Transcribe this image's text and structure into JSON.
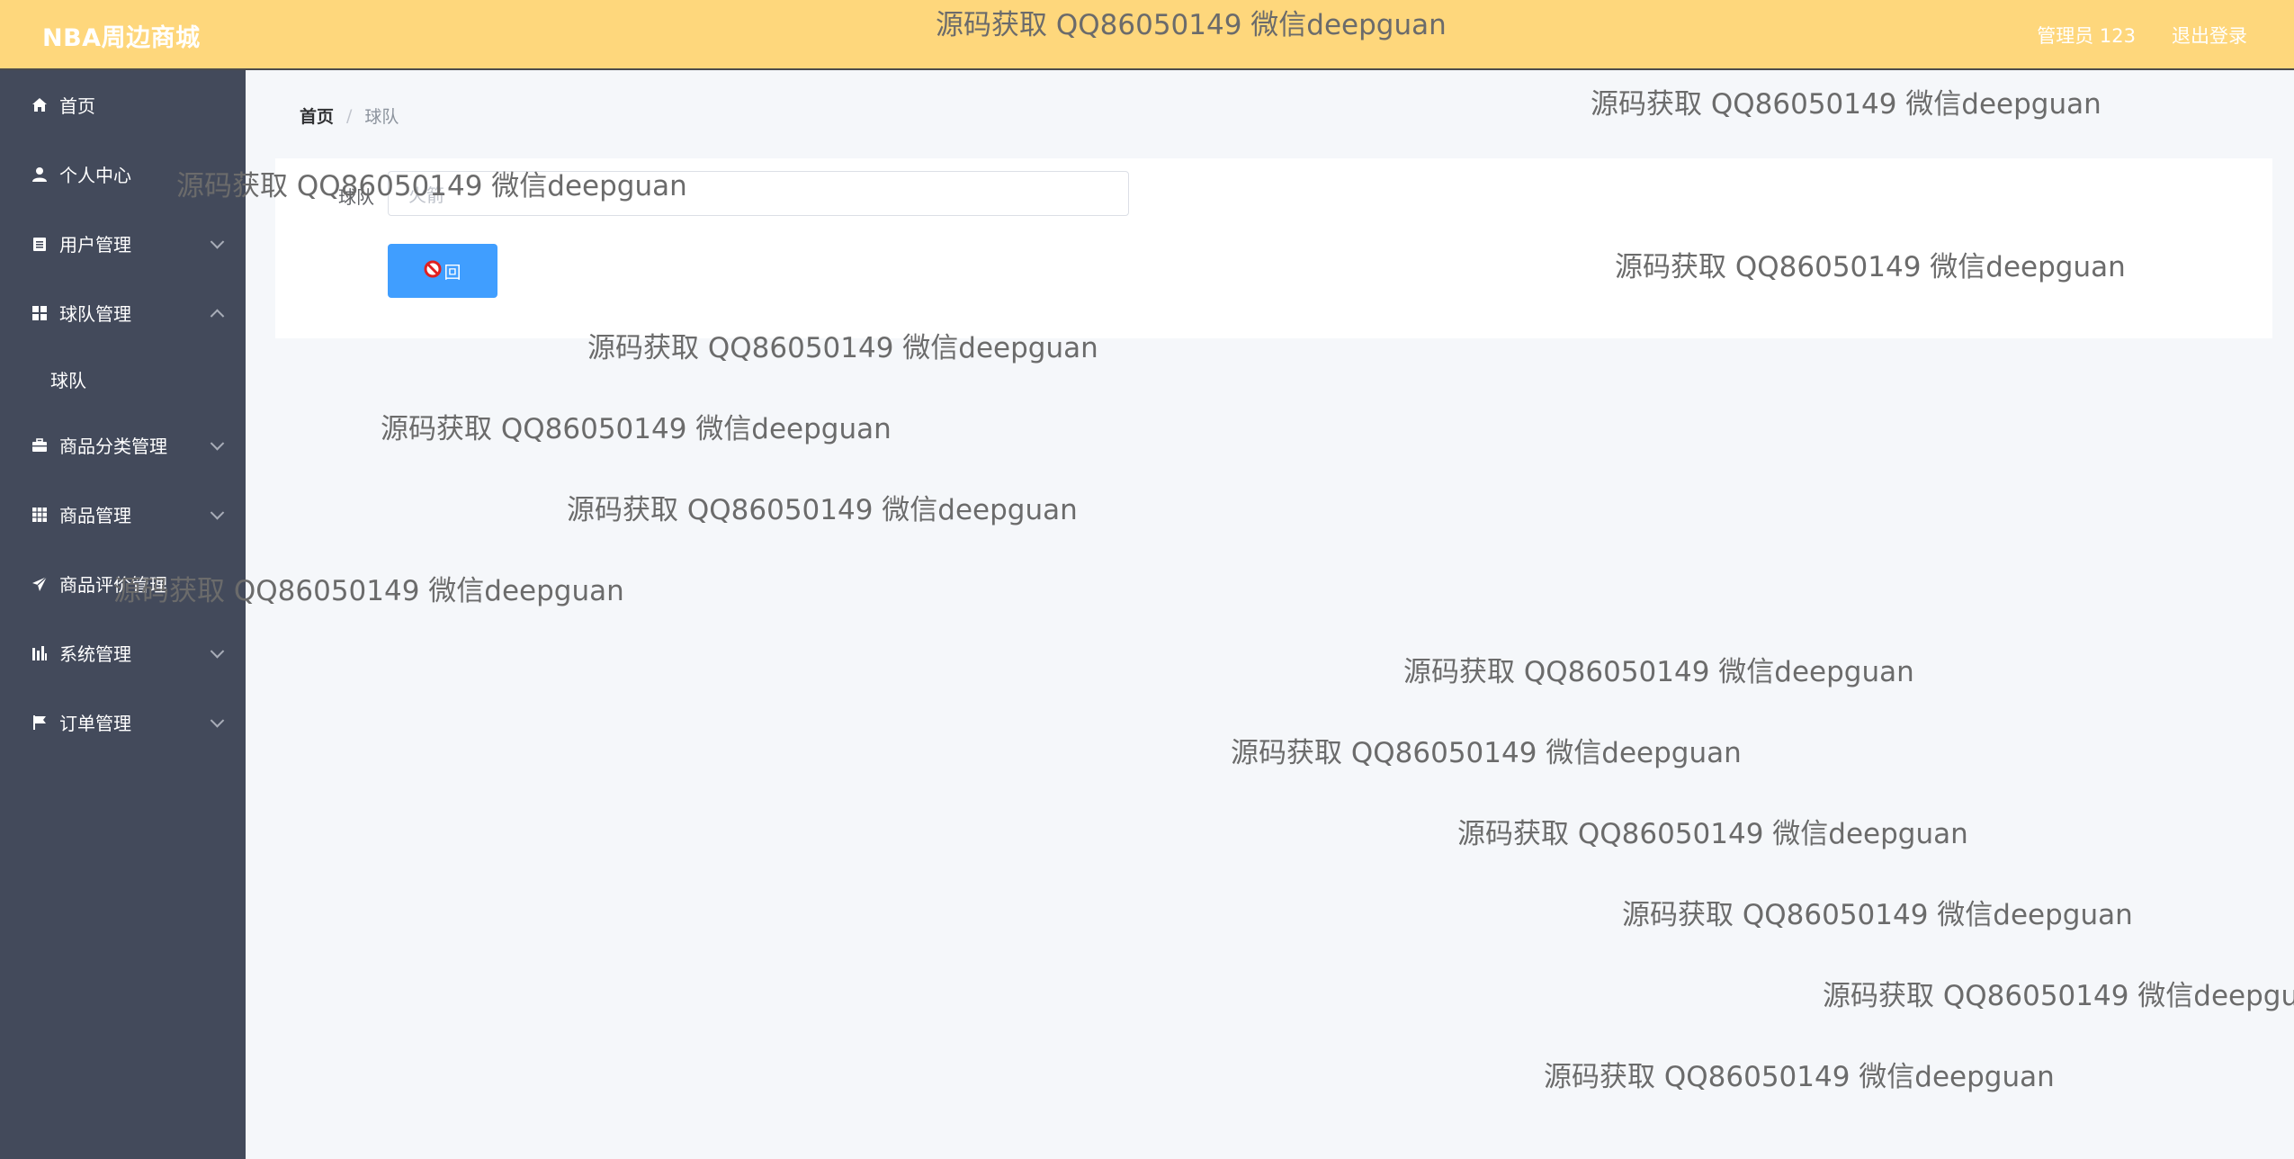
{
  "header": {
    "brand": "NBA周边商城",
    "user_label": "管理员 123",
    "logout_label": "退出登录",
    "background_color": "#fed77c"
  },
  "sidebar": {
    "background_color": "#434a5b",
    "items": [
      {
        "label": "首页",
        "icon": "home-icon",
        "has_children": false
      },
      {
        "label": "个人中心",
        "icon": "user-icon",
        "has_children": false
      },
      {
        "label": "用户管理",
        "icon": "clipboard-icon",
        "has_children": true,
        "expanded": false
      },
      {
        "label": "球队管理",
        "icon": "grid-icon",
        "has_children": true,
        "expanded": true,
        "children": [
          "球队"
        ]
      },
      {
        "label": "商品分类管理",
        "icon": "briefcase-icon",
        "has_children": true,
        "expanded": false
      },
      {
        "label": "商品管理",
        "icon": "apps-icon",
        "has_children": true,
        "expanded": false
      },
      {
        "label": "商品评价管理",
        "icon": "paper-plane-icon",
        "has_children": false
      },
      {
        "label": "系统管理",
        "icon": "chart-icon",
        "has_children": true,
        "expanded": false
      },
      {
        "label": "订单管理",
        "icon": "flag-icon",
        "has_children": true,
        "expanded": false
      }
    ]
  },
  "breadcrumb": {
    "home": "首页",
    "separator": "/",
    "current": "球队"
  },
  "form": {
    "field_label": "球队",
    "field_value": "火箭",
    "back_button_label": "回",
    "accent_color": "#409eff"
  },
  "watermark": {
    "text": "源码获取 QQ86050149 微信deepguan"
  }
}
